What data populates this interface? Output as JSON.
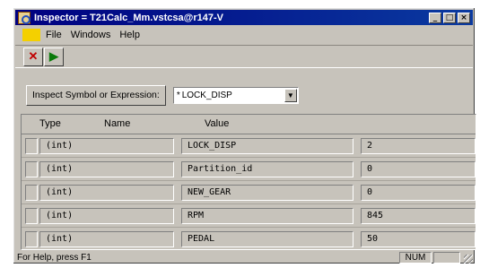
{
  "window": {
    "title": "Inspector = T21Calc_Mm.vstcsa@r147-V",
    "minimize_glyph": "_",
    "maximize_glyph": "□",
    "close_glyph": "×"
  },
  "menu": {
    "items": [
      {
        "label": "File"
      },
      {
        "label": "Windows"
      },
      {
        "label": "Help"
      }
    ]
  },
  "toolbar": {
    "buttons": [
      {
        "icon": "stop-icon",
        "glyph": "✕"
      },
      {
        "icon": "refresh-icon",
        "glyph": "▶"
      }
    ]
  },
  "inspect": {
    "button_label": "Inspect Symbol or Expression:",
    "combo_prefix": "*",
    "combo_value": "LOCK_DISP",
    "combo_arrow": "▼"
  },
  "grid": {
    "headers": {
      "type": "Type",
      "name": "Name",
      "value": "Value"
    },
    "rows": [
      {
        "type": "(int)",
        "name": "LOCK_DISP",
        "value": "2"
      },
      {
        "type": "(int)",
        "name": "Partition_id",
        "value": "0"
      },
      {
        "type": "(int)",
        "name": "NEW_GEAR",
        "value": "0"
      },
      {
        "type": "(int)",
        "name": "RPM",
        "value": "845"
      },
      {
        "type": "(int)",
        "name": "PEDAL",
        "value": "50"
      }
    ]
  },
  "status": {
    "text": "For Help, press F1",
    "num": "NUM"
  },
  "colors": {
    "titlebar": "#000080",
    "face": "#c7c3bb"
  }
}
